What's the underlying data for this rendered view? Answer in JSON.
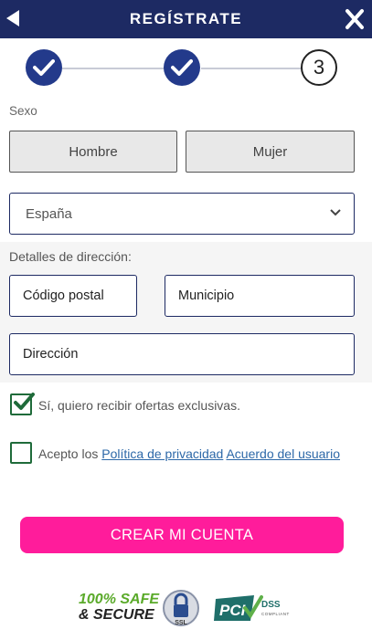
{
  "header": {
    "title": "REGÍSTRATE"
  },
  "steps": {
    "current_number": "3"
  },
  "gender": {
    "label": "Sexo",
    "options": [
      "Hombre",
      "Mujer"
    ]
  },
  "country": {
    "selected": "España"
  },
  "address": {
    "label": "Detalles de dirección:",
    "postal_placeholder": "Código postal",
    "city_placeholder": "Municipio",
    "street_placeholder": "Dirección"
  },
  "offers": {
    "checked": true,
    "text": "Sí, quiero recibir ofertas exclusivas."
  },
  "terms": {
    "checked": false,
    "prefix": "Acepto los ",
    "privacy_link": "Política de privacidad",
    "agreement_link": "Acuerdo del usuario"
  },
  "cta_label": "CREAR MI CUENTA",
  "badges": {
    "safe_line1": "100% SAFE",
    "safe_line2": "& SECURE",
    "ssl_text": "SSL",
    "pci_text": "PCI",
    "dss_text": "DSS",
    "compliant_text": "COMPLIANT"
  },
  "colors": {
    "header_bg": "#1d2a63",
    "step_done": "#233a8b",
    "cta": "#ff1c9b",
    "checkbox": "#1f6b3a",
    "link": "#2d68a8"
  }
}
